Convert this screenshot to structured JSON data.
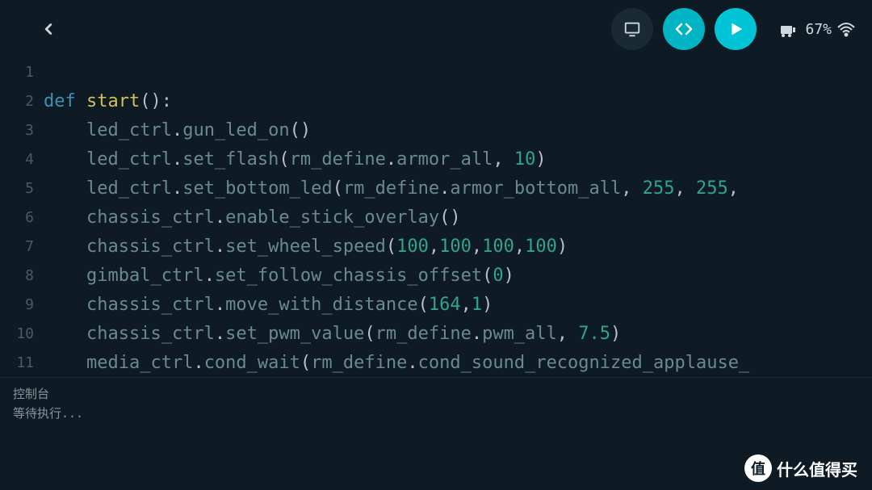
{
  "status": {
    "battery": "67%"
  },
  "code": {
    "lines": [
      {
        "n": "1",
        "tokens": []
      },
      {
        "n": "2",
        "tokens": [
          {
            "t": "def ",
            "c": "kw"
          },
          {
            "t": "start",
            "c": "fn"
          },
          {
            "t": "():",
            "c": "punct"
          }
        ]
      },
      {
        "n": "3",
        "tokens": [
          {
            "t": "    led_ctrl",
            "c": "ident"
          },
          {
            "t": ".",
            "c": "punct"
          },
          {
            "t": "gun_led_on",
            "c": "ident"
          },
          {
            "t": "()",
            "c": "punct"
          }
        ]
      },
      {
        "n": "4",
        "tokens": [
          {
            "t": "    led_ctrl",
            "c": "ident"
          },
          {
            "t": ".",
            "c": "punct"
          },
          {
            "t": "set_flash",
            "c": "ident"
          },
          {
            "t": "(",
            "c": "punct"
          },
          {
            "t": "rm_define",
            "c": "ident"
          },
          {
            "t": ".",
            "c": "punct"
          },
          {
            "t": "armor_all",
            "c": "ident"
          },
          {
            "t": ", ",
            "c": "punct"
          },
          {
            "t": "10",
            "c": "num"
          },
          {
            "t": ")",
            "c": "punct"
          }
        ]
      },
      {
        "n": "5",
        "tokens": [
          {
            "t": "    led_ctrl",
            "c": "ident"
          },
          {
            "t": ".",
            "c": "punct"
          },
          {
            "t": "set_bottom_led",
            "c": "ident"
          },
          {
            "t": "(",
            "c": "punct"
          },
          {
            "t": "rm_define",
            "c": "ident"
          },
          {
            "t": ".",
            "c": "punct"
          },
          {
            "t": "armor_bottom_all",
            "c": "ident"
          },
          {
            "t": ", ",
            "c": "punct"
          },
          {
            "t": "255",
            "c": "num"
          },
          {
            "t": ", ",
            "c": "punct"
          },
          {
            "t": "255",
            "c": "num"
          },
          {
            "t": ",",
            "c": "punct"
          }
        ]
      },
      {
        "n": "6",
        "tokens": [
          {
            "t": "    chassis_ctrl",
            "c": "ident"
          },
          {
            "t": ".",
            "c": "punct"
          },
          {
            "t": "enable_stick_overlay",
            "c": "ident"
          },
          {
            "t": "()",
            "c": "punct"
          }
        ]
      },
      {
        "n": "7",
        "tokens": [
          {
            "t": "    chassis_ctrl",
            "c": "ident"
          },
          {
            "t": ".",
            "c": "punct"
          },
          {
            "t": "set_wheel_speed",
            "c": "ident"
          },
          {
            "t": "(",
            "c": "punct"
          },
          {
            "t": "100",
            "c": "num"
          },
          {
            "t": ",",
            "c": "punct"
          },
          {
            "t": "100",
            "c": "num"
          },
          {
            "t": ",",
            "c": "punct"
          },
          {
            "t": "100",
            "c": "num"
          },
          {
            "t": ",",
            "c": "punct"
          },
          {
            "t": "100",
            "c": "num"
          },
          {
            "t": ")",
            "c": "punct"
          }
        ]
      },
      {
        "n": "8",
        "tokens": [
          {
            "t": "    gimbal_ctrl",
            "c": "ident"
          },
          {
            "t": ".",
            "c": "punct"
          },
          {
            "t": "set_follow_chassis_offset",
            "c": "ident"
          },
          {
            "t": "(",
            "c": "punct"
          },
          {
            "t": "0",
            "c": "num"
          },
          {
            "t": ")",
            "c": "punct"
          }
        ]
      },
      {
        "n": "9",
        "tokens": [
          {
            "t": "    chassis_ctrl",
            "c": "ident"
          },
          {
            "t": ".",
            "c": "punct"
          },
          {
            "t": "move_with_distance",
            "c": "ident"
          },
          {
            "t": "(",
            "c": "punct"
          },
          {
            "t": "164",
            "c": "num"
          },
          {
            "t": ",",
            "c": "punct"
          },
          {
            "t": "1",
            "c": "num"
          },
          {
            "t": ")",
            "c": "punct"
          }
        ]
      },
      {
        "n": "10",
        "tokens": [
          {
            "t": "    chassis_ctrl",
            "c": "ident"
          },
          {
            "t": ".",
            "c": "punct"
          },
          {
            "t": "set_pwm_value",
            "c": "ident"
          },
          {
            "t": "(",
            "c": "punct"
          },
          {
            "t": "rm_define",
            "c": "ident"
          },
          {
            "t": ".",
            "c": "punct"
          },
          {
            "t": "pwm_all",
            "c": "ident"
          },
          {
            "t": ", ",
            "c": "punct"
          },
          {
            "t": "7.5",
            "c": "num"
          },
          {
            "t": ")",
            "c": "punct"
          }
        ]
      },
      {
        "n": "11",
        "tokens": [
          {
            "t": "    media_ctrl",
            "c": "ident"
          },
          {
            "t": ".",
            "c": "punct"
          },
          {
            "t": "cond_wait",
            "c": "ident"
          },
          {
            "t": "(",
            "c": "punct"
          },
          {
            "t": "rm_define",
            "c": "ident"
          },
          {
            "t": ".",
            "c": "punct"
          },
          {
            "t": "cond_sound_recognized_applause_",
            "c": "ident"
          }
        ]
      }
    ]
  },
  "console": {
    "title": "控制台",
    "status": "等待执行..."
  },
  "watermark": {
    "badge": "值",
    "text": "什么值得买"
  }
}
